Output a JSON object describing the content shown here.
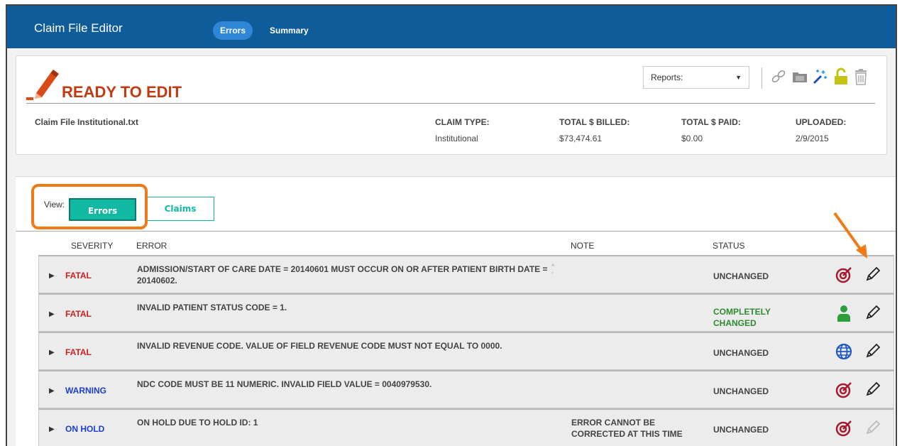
{
  "header": {
    "app_title": "Claim File Editor",
    "tabs": [
      {
        "label": "Errors",
        "active": true
      },
      {
        "label": "Summary",
        "active": false
      }
    ]
  },
  "claim": {
    "status_title": "READY TO EDIT",
    "reports_label": "Reports:",
    "file_name": "Claim File Institutional.txt",
    "fields": [
      {
        "label": "CLAIM TYPE:",
        "value": "Institutional"
      },
      {
        "label": "TOTAL $ BILLED:",
        "value": "$73,474.61"
      },
      {
        "label": "TOTAL $ PAID:",
        "value": "$0.00"
      },
      {
        "label": "UPLOADED:",
        "value": "2/9/2015"
      }
    ],
    "toolbar_icons": [
      "link-icon",
      "folder-icon",
      "magic-wand-icon",
      "unlock-icon",
      "trash-icon"
    ]
  },
  "view": {
    "label": "View:",
    "errors_button": "Errors",
    "claims_button": "Claims"
  },
  "table": {
    "headers": {
      "severity": "SEVERITY",
      "error": "ERROR",
      "note": "NOTE",
      "status": "STATUS"
    },
    "rows": [
      {
        "severity": "FATAL",
        "error": "ADMISSION/START OF CARE DATE = 20140601 MUST OCCUR ON OR AFTER PATIENT BIRTH DATE = 20140602.",
        "note": "",
        "status": "UNCHANGED",
        "icon": "target-icon"
      },
      {
        "severity": "FATAL",
        "error": "INVALID PATIENT STATUS CODE = 1.",
        "note": "",
        "status": "COMPLETELY CHANGED",
        "icon": "person-icon"
      },
      {
        "severity": "FATAL",
        "error": "INVALID REVENUE CODE. VALUE OF FIELD REVENUE CODE MUST NOT EQUAL TO 0000.",
        "note": "",
        "status": "UNCHANGED",
        "icon": "globe-icon"
      },
      {
        "severity": "WARNING",
        "error": "NDC CODE MUST BE 11 NUMERIC. INVALID FIELD VALUE = 0040979530.",
        "note": "",
        "status": "UNCHANGED",
        "icon": "target-icon"
      },
      {
        "severity": "ON HOLD",
        "error": "ON HOLD DUE TO HOLD ID: 1",
        "note": "ERROR CANNOT BE CORRECTED AT THIS TIME",
        "status": "UNCHANGED",
        "icon": "target-icon"
      }
    ]
  },
  "colors": {
    "header_bg": "#0f5c9b",
    "accent": "#11b9a3",
    "fatal": "#d11f1f",
    "warning": "#1c3fd1",
    "changed": "#2e8b2e",
    "highlight": "#f07b16"
  }
}
